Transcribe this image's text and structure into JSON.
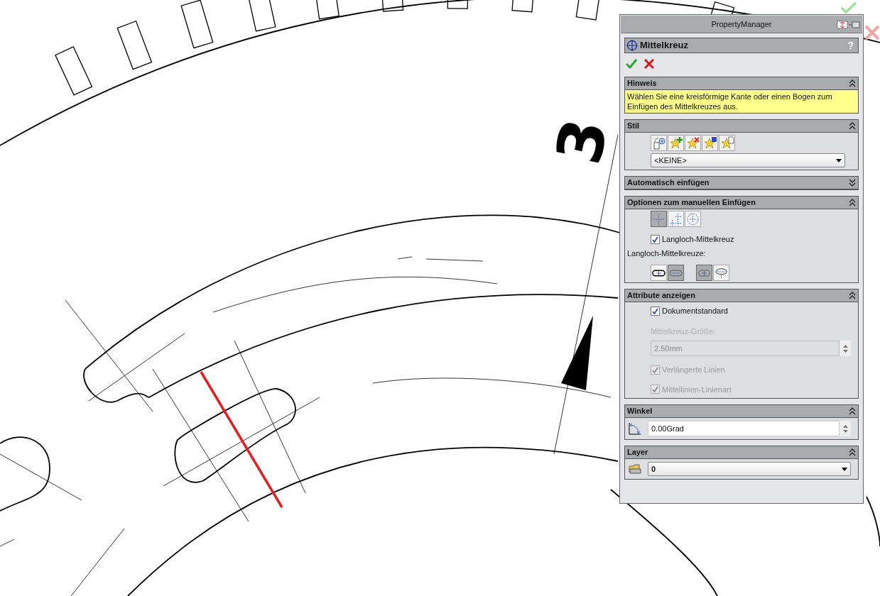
{
  "drawing": {
    "label": "3"
  },
  "panel": {
    "title": "PropertyManager"
  },
  "feature": {
    "title": "Mittelkreuz",
    "help": "?"
  },
  "hint": {
    "title": "Hinweis",
    "expanded": true,
    "text": "Wählen Sie eine kreisförmige Kante oder einen Bogen zum Einfügen des Mittelkreuzes aus."
  },
  "style": {
    "title": "Stil",
    "expanded": true,
    "dropdown": "<KEINE>"
  },
  "auto_insert": {
    "title": "Automatisch einfügen",
    "expanded": false
  },
  "manual": {
    "title": "Optionen zum manuellen Einfügen",
    "expanded": true,
    "types": [
      {
        "selected": true
      },
      {
        "selected": false
      },
      {
        "selected": false
      }
    ],
    "slot_checkbox": {
      "label": "Langloch-Mittelkreuz",
      "checked": true
    },
    "slot_label": "Langloch-Mittelkreuze:",
    "slot_types": [
      {
        "selected": false
      },
      {
        "selected": true
      },
      {
        "selected": true
      },
      {
        "selected": false
      }
    ]
  },
  "attributes": {
    "title": "Attribute anzeigen",
    "expanded": true,
    "doc_default": {
      "label": "Dokumentstandard",
      "checked": true
    },
    "size_label": "Mittelkreuz-Größe:",
    "size_value": "2.50mm",
    "disabled": true,
    "options": [
      {
        "label": "Verlängerte Linien",
        "checked": true
      },
      {
        "label": "Mittellinien-Linienart",
        "checked": true
      }
    ]
  },
  "angle": {
    "title": "Winkel",
    "expanded": true,
    "value": "0.00Grad"
  },
  "layer": {
    "title": "Layer",
    "expanded": true,
    "value": "0"
  }
}
